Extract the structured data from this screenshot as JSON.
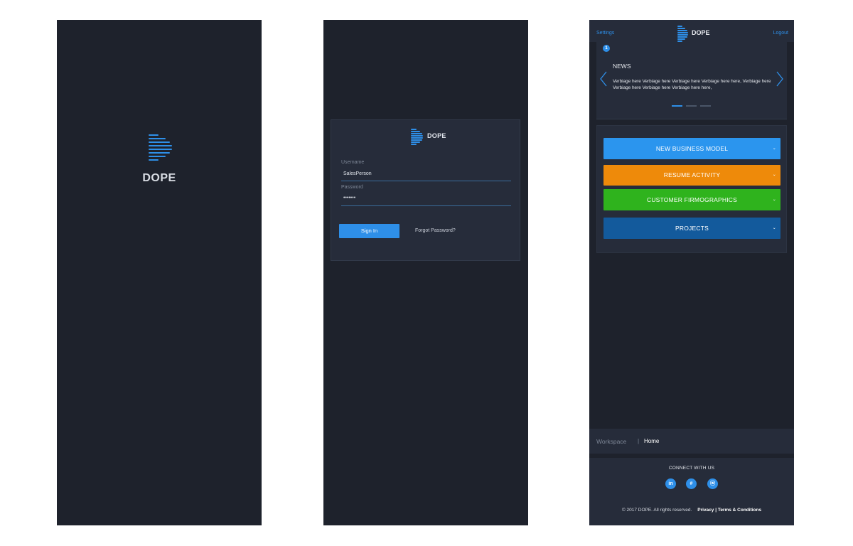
{
  "brand": {
    "name": "DOPE",
    "accent": "#2e8fe8",
    "background": "#1e222c",
    "card": "#262c3a"
  },
  "splash": {
    "logo_text": "DOPE"
  },
  "login": {
    "logo_text": "DOPE",
    "username_label": "Username",
    "username_value": "SalesPerson",
    "password_label": "Password",
    "password_value": "•••••••",
    "signin_label": "Sign In",
    "forgot_label": "Forgot Password?"
  },
  "workspace": {
    "topbar": {
      "settings_label": "Settings",
      "logo_text": "DOPE",
      "logout_label": "Logout"
    },
    "news": {
      "badge": "1",
      "title": "NEWS",
      "body": "Verbiage here Verbiage here Verbiage here Verbiage here here, Verbiage here Verbiage here Verbiage here Verbiage here here,",
      "pages": 3,
      "active_page": 1
    },
    "menu": [
      {
        "label": "NEW BUSINESS MODEL",
        "color": "#2b95ee",
        "caret": "⌄"
      },
      {
        "label": "RESUME ACTIVITY",
        "color": "#ee8a0a",
        "caret": "⌄"
      },
      {
        "label": "CUSTOMER FIRMOGRAPHICS",
        "color": "#2fb31d",
        "caret": "⌄"
      },
      {
        "label": "PROJECTS",
        "color": "#135a9c",
        "caret": "⌄"
      }
    ],
    "breadcrumb": {
      "section": "Workspace",
      "separator": "|",
      "current": "Home"
    },
    "footer": {
      "connect": "CONNECT WITH US",
      "social": [
        "in",
        "#",
        "ⓦ"
      ],
      "copyright": "© 2017 DOPE. All rights reserved.",
      "links": "Privacy | Terms & Conditions"
    }
  }
}
